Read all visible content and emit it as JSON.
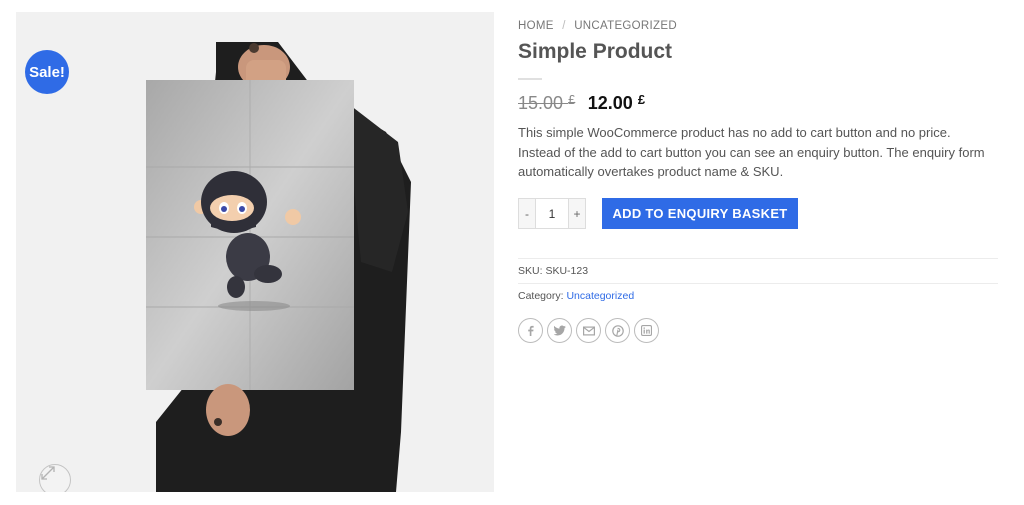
{
  "gallery": {
    "sale_badge": "Sale!",
    "zoom_icon": "expand-icon"
  },
  "breadcrumb": {
    "home": "HOME",
    "separator": "/",
    "category": "UNCATEGORIZED"
  },
  "product": {
    "title": "Simple Product",
    "old_price": "15.00",
    "new_price": "12.00",
    "currency": "£",
    "description": "This simple WooCommerce product has no add to cart button and no price. Instead of the add to cart button you can see an enquiry button. The enquiry form automatically overtakes product name & SKU.",
    "quantity": "1",
    "minus_label": "-",
    "plus_label": "+",
    "enquiry_button": "ADD TO ENQUIRY BASKET"
  },
  "meta": {
    "sku_label": "SKU:",
    "sku": "SKU-123",
    "category_label": "Category:",
    "category": "Uncategorized"
  },
  "share": [
    "facebook-icon",
    "twitter-icon",
    "email-icon",
    "pinterest-icon",
    "linkedin-icon"
  ],
  "colors": {
    "accent": "#2f6be6",
    "gallery_bg": "#f1f1f1"
  }
}
